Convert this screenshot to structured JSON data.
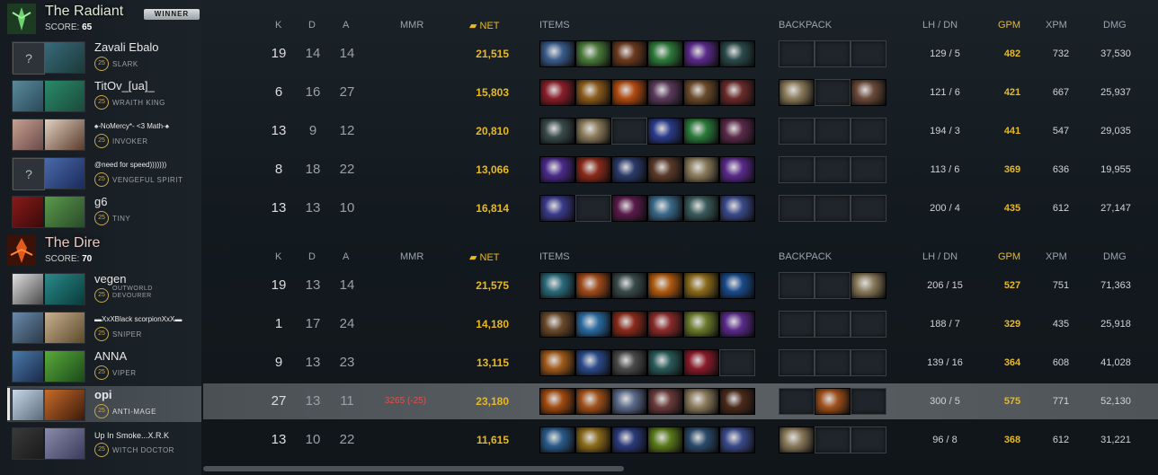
{
  "headers": {
    "k": "K",
    "d": "D",
    "a": "A",
    "mmr": "MMR",
    "net": "NET",
    "items": "ITEMS",
    "backpack": "BACKPACK",
    "lhdn": "LH / DN",
    "gpm": "GPM",
    "xpm": "XPM",
    "dmg": "DMG"
  },
  "radiant": {
    "name": "The Radiant",
    "score_label": "SCORE:",
    "score": "65",
    "badge": "WINNER",
    "players": [
      {
        "name": "Zavali Ebalo",
        "level": "25",
        "hero": "SLARK",
        "k": "19",
        "d": "14",
        "a": "14",
        "mmr": "",
        "net": "21,515",
        "lh": "129",
        "dn": "5",
        "gpm": "482",
        "xpm": "732",
        "dmg": "37,530"
      },
      {
        "name": "TitOv_[ua]_",
        "level": "25",
        "hero": "WRAITH KING",
        "k": "6",
        "d": "16",
        "a": "27",
        "mmr": "",
        "net": "15,803",
        "lh": "121",
        "dn": "6",
        "gpm": "421",
        "xpm": "667",
        "dmg": "25,937"
      },
      {
        "name": "♠-NoMercy*- <3 Math-♠",
        "level": "25",
        "hero": "INVOKER",
        "k": "13",
        "d": "9",
        "a": "12",
        "mmr": "",
        "net": "20,810",
        "lh": "194",
        "dn": "3",
        "gpm": "441",
        "xpm": "547",
        "dmg": "29,035"
      },
      {
        "name": "@need for speed)))))))",
        "level": "25",
        "hero": "VENGEFUL SPIRIT",
        "k": "8",
        "d": "18",
        "a": "22",
        "mmr": "",
        "net": "13,066",
        "lh": "113",
        "dn": "6",
        "gpm": "369",
        "xpm": "636",
        "dmg": "19,955"
      },
      {
        "name": "g6",
        "level": "25",
        "hero": "TINY",
        "k": "13",
        "d": "13",
        "a": "10",
        "mmr": "",
        "net": "16,814",
        "lh": "200",
        "dn": "4",
        "gpm": "435",
        "xpm": "612",
        "dmg": "27,147"
      }
    ]
  },
  "dire": {
    "name": "The Dire",
    "score_label": "SCORE:",
    "score": "70",
    "players": [
      {
        "name": "vegen",
        "level": "25",
        "hero": "OUTWORLD DEVOURER",
        "k": "19",
        "d": "13",
        "a": "14",
        "mmr": "",
        "net": "21,575",
        "lh": "206",
        "dn": "15",
        "gpm": "527",
        "xpm": "751",
        "dmg": "71,363"
      },
      {
        "name": "▬XxXBlack scorpionXxX▬",
        "level": "25",
        "hero": "SNIPER",
        "k": "1",
        "d": "17",
        "a": "24",
        "mmr": "",
        "net": "14,180",
        "lh": "188",
        "dn": "7",
        "gpm": "329",
        "xpm": "435",
        "dmg": "25,918"
      },
      {
        "name": "ANNA",
        "level": "25",
        "hero": "VIPER",
        "k": "9",
        "d": "13",
        "a": "23",
        "mmr": "",
        "net": "13,115",
        "lh": "139",
        "dn": "16",
        "gpm": "364",
        "xpm": "608",
        "dmg": "41,028"
      },
      {
        "name": "opi",
        "level": "25",
        "hero": "ANTI-MAGE",
        "k": "27",
        "d": "13",
        "a": "11",
        "mmr": "3265 (-25)",
        "net": "23,180",
        "lh": "300",
        "dn": "5",
        "gpm": "575",
        "xpm": "771",
        "dmg": "52,130"
      },
      {
        "name": "Up In Smoke...X.R.K",
        "level": "25",
        "hero": "WITCH DOCTOR",
        "k": "13",
        "d": "10",
        "a": "22",
        "mmr": "",
        "net": "11,615",
        "lh": "96",
        "dn": "8",
        "gpm": "368",
        "xpm": "612",
        "dmg": "31,221"
      }
    ]
  },
  "colors": {
    "gold": "#e8b923",
    "radiant": "#4caf50",
    "dire": "#c0392b"
  },
  "item_colors": [
    [
      "#3a5c8c",
      "#4a7a3a",
      "#6b3a1e",
      "#2e7a3a",
      "#5a2a8a",
      "#2a4a4a"
    ],
    [
      "#8a1e2a",
      "#8a5a1a",
      "#b04a10",
      "#5a3a5a",
      "#6a4a2a",
      "#6a2a2a"
    ],
    [
      "#3a4a4a",
      "#8a7a5a",
      "",
      "#2a3a8a",
      "#2a7a3a",
      "#5a2a4a"
    ],
    [
      "#4a2a8a",
      "#8a2a1a",
      "#2a3a6a",
      "#5a3a2a",
      "#8a7a5a",
      "#5a2a8a"
    ],
    [
      "#3a3a8a",
      "",
      "#5a1a4a",
      "#3a6a8a",
      "#3a5a5a",
      "#3a4a8a"
    ],
    [
      "#2a6a7a",
      "#a04a1a",
      "#3a4a4a",
      "#b05a10",
      "#8a6a1a",
      "#1a4a8a"
    ],
    [
      "#6a4a2a",
      "#2a6aa0",
      "#8a2a1a",
      "#8a2a2a",
      "#6a7a2a",
      "#5a2a8a"
    ],
    [
      "#a05a1a",
      "#2a4a8a",
      "#4a4a4a",
      "#2a5a5a",
      "#8a1a2a",
      ""
    ],
    [
      "#a04a10",
      "#a0501a",
      "#5a6a8a",
      "#6a3a3a",
      "#8a7a5a",
      "#4a2a1a"
    ],
    [
      "#2a5a8a",
      "#8a6a1a",
      "#2a3a7a",
      "#5a7a1a",
      "#2a4a6a",
      "#3a4a8a"
    ]
  ],
  "backpack": [
    [
      "",
      "",
      ""
    ],
    [
      "#8a7a5a",
      "",
      "#6a4a3a"
    ],
    [
      "",
      "",
      ""
    ],
    [
      "",
      "",
      ""
    ],
    [
      "",
      "",
      ""
    ],
    [
      "",
      "",
      "#8a7a5a"
    ],
    [
      "",
      "",
      ""
    ],
    [
      "",
      "",
      ""
    ],
    [
      "",
      "#a0501a",
      ""
    ],
    [
      "#8a7a5a",
      "",
      ""
    ]
  ]
}
